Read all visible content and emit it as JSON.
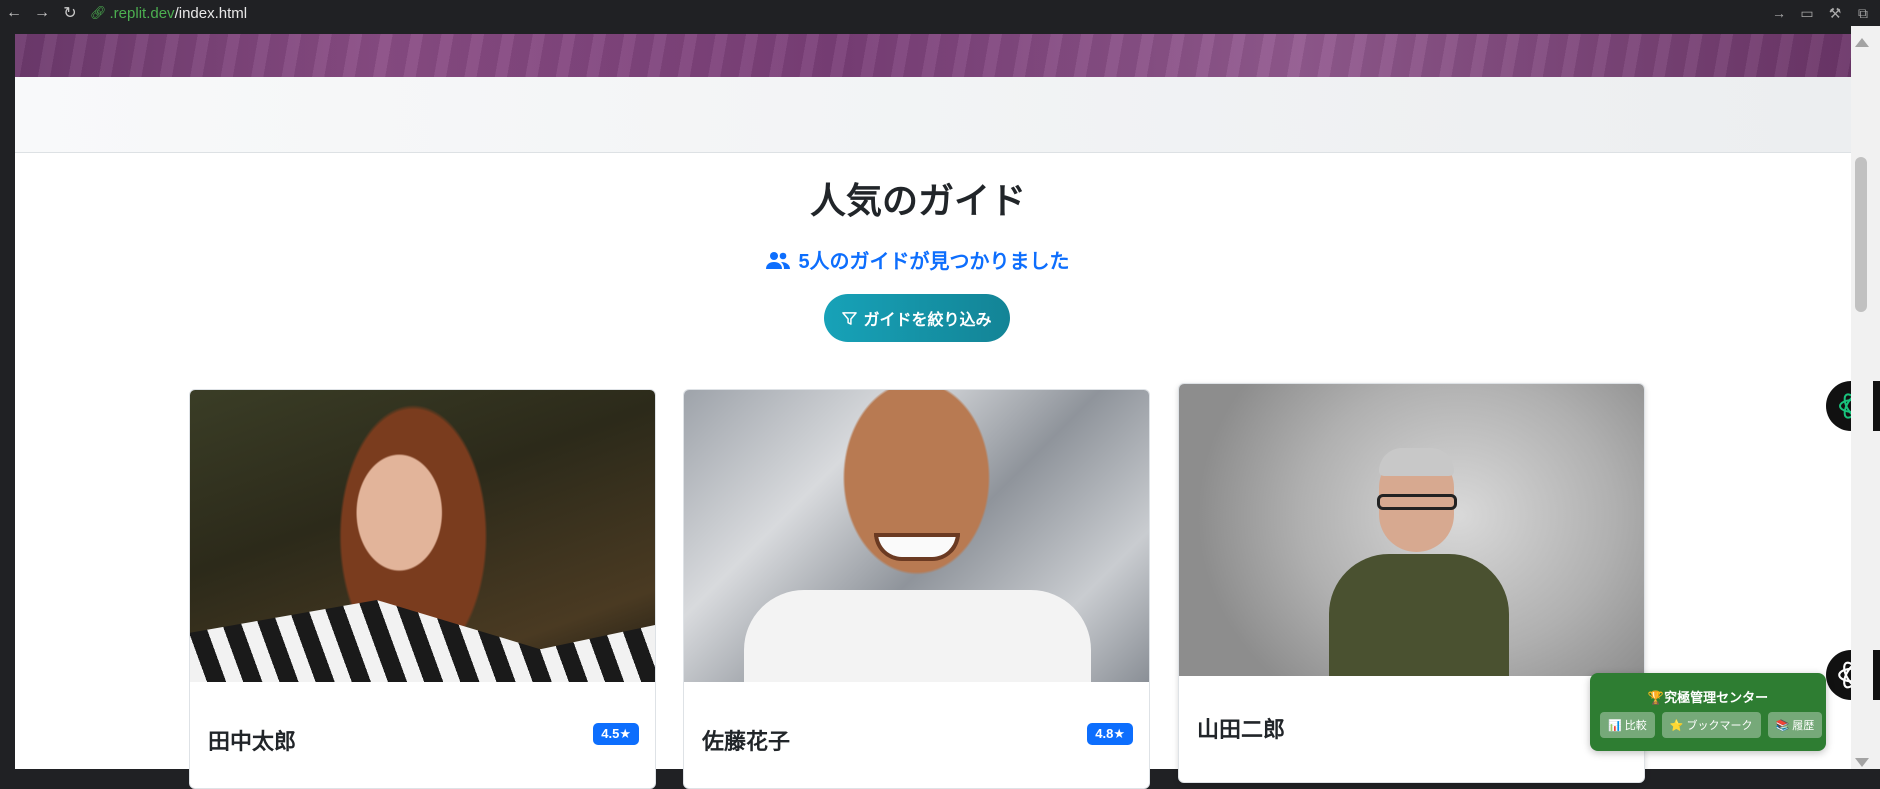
{
  "browser": {
    "url_host": ".replit.dev",
    "url_path": "/index.html"
  },
  "main": {
    "section_title": "人気のガイド",
    "found_text": "5人のガイドが見つかりました",
    "filter_label": "ガイドを絞り込み"
  },
  "guides": [
    {
      "name": "田中太郎",
      "rating": "4.5★"
    },
    {
      "name": "佐藤花子",
      "rating": "4.8★"
    },
    {
      "name": "山田二郎",
      "rating": ""
    }
  ],
  "manager": {
    "title": "🏆究極管理センター",
    "buttons": [
      "📊 比較",
      "⭐ ブックマーク",
      "📚 履歴"
    ]
  },
  "icons": {
    "back": "arrow-left-icon",
    "forward": "arrow-right-icon",
    "reload": "reload-icon",
    "link": "link-icon",
    "users": "users-icon",
    "filter": "filter-icon",
    "ai": "ai-logo-icon"
  },
  "colors": {
    "accent": "#0d6efd",
    "filter_button": "#17a2b8",
    "manager_panel": "#2e7d32"
  }
}
